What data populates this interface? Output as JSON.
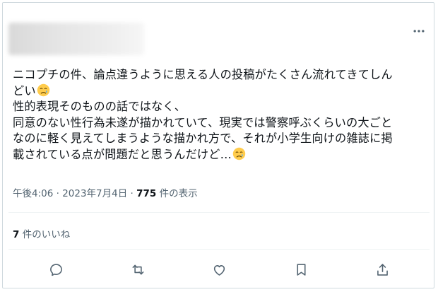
{
  "tweet": {
    "lines": [
      "ニコプチの件、論点違うように思える人の投稿がたくさん流れてきてしん",
      "どい",
      "性的表現そのものの話ではなく、",
      "同意のない性行為未遂が描かれていて、現実では警察呼ぶくらいの大ごと",
      "なのに軽く見えてしまうような描かれ方で、それが小学生向けの雑誌に掲",
      "載されている点が問題だと思うんだけど…"
    ]
  },
  "meta": {
    "timestamp": "午後4:06 · 2023年7月4日 · ",
    "view_count": "775",
    "view_suffix": " 件の表示"
  },
  "likes": {
    "count": "7",
    "suffix": " 件のいいね"
  },
  "icons": {
    "more": "more-icon",
    "emoji": "crying-face-emoji",
    "reply": "reply-icon",
    "retweet": "retweet-icon",
    "like": "heart-icon",
    "bookmark": "bookmark-icon",
    "share": "share-icon"
  },
  "colors": {
    "text": "#0f1419",
    "secondary": "#536471",
    "border": "#cfd9de",
    "divider": "#eff3f4"
  }
}
